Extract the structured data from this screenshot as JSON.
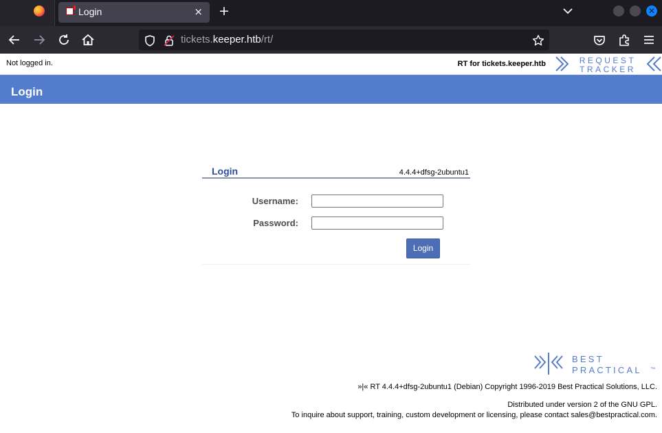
{
  "browser": {
    "tab_title": "Login",
    "tab_close": "×",
    "new_tab": "+",
    "url": {
      "prefix": "tickets.",
      "host": "keeper.htb",
      "path": "/rt/"
    },
    "accent": "#0a84ff"
  },
  "rt": {
    "status": "Not logged in.",
    "rt_for": "RT for tickets.keeper.htb",
    "logo_words": [
      "REQUEST",
      "TRACKER"
    ],
    "header_title": "Login",
    "header_color": "#547ccc"
  },
  "login": {
    "title": "Login",
    "version": "4.4.4+dfsg-2ubuntu1",
    "username_label": "Username:",
    "password_label": "Password:",
    "username_value": "",
    "password_value": "",
    "button_label": "Login"
  },
  "footer": {
    "logo_words": [
      "BEST",
      "PRACTICAL",
      "™"
    ],
    "copyright": "»|« RT 4.4.4+dfsg-2ubuntu1 (Debian) Copyright 1996-2019 Best Practical Solutions, LLC.",
    "license": "Distributed under version 2 of the GNU GPL.",
    "contact": "To inquire about support, training, custom development or licensing, please contact sales@bestpractical.com."
  }
}
